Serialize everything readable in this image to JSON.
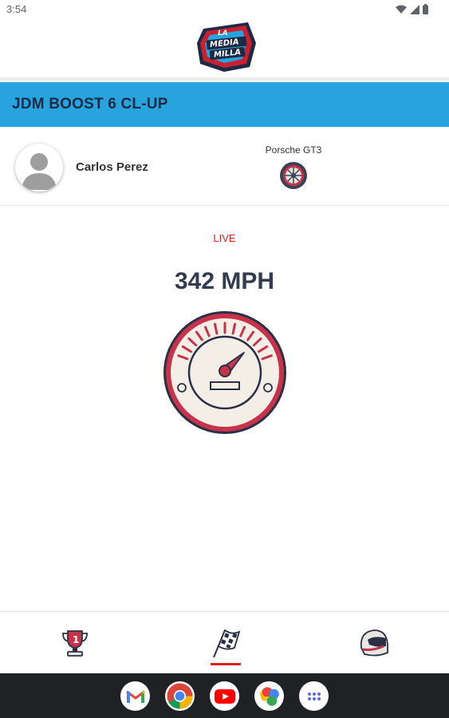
{
  "status_bar": {
    "time": "3:54"
  },
  "header": {
    "logo_name": "la-media-milla-logo"
  },
  "title_bar": {
    "title": "JDM BOOST 6 CL-UP"
  },
  "driver": {
    "name": "Carlos Perez",
    "car": "Porsche GT3"
  },
  "live": {
    "label": "LIVE",
    "speed": "342 MPH"
  },
  "colors": {
    "accent_blue": "#27a4dd",
    "live_red": "#e02020",
    "gauge_red": "#c8324a",
    "navy": "#1d2a45"
  },
  "bottom_nav": {
    "items": [
      {
        "icon": "trophy-icon",
        "active": false
      },
      {
        "icon": "checkered-flag-icon",
        "active": true
      },
      {
        "icon": "helmet-icon",
        "active": false
      }
    ]
  },
  "dock": {
    "apps": [
      "gmail-icon",
      "chrome-icon",
      "youtube-icon",
      "photos-icon",
      "app-drawer-icon"
    ]
  }
}
